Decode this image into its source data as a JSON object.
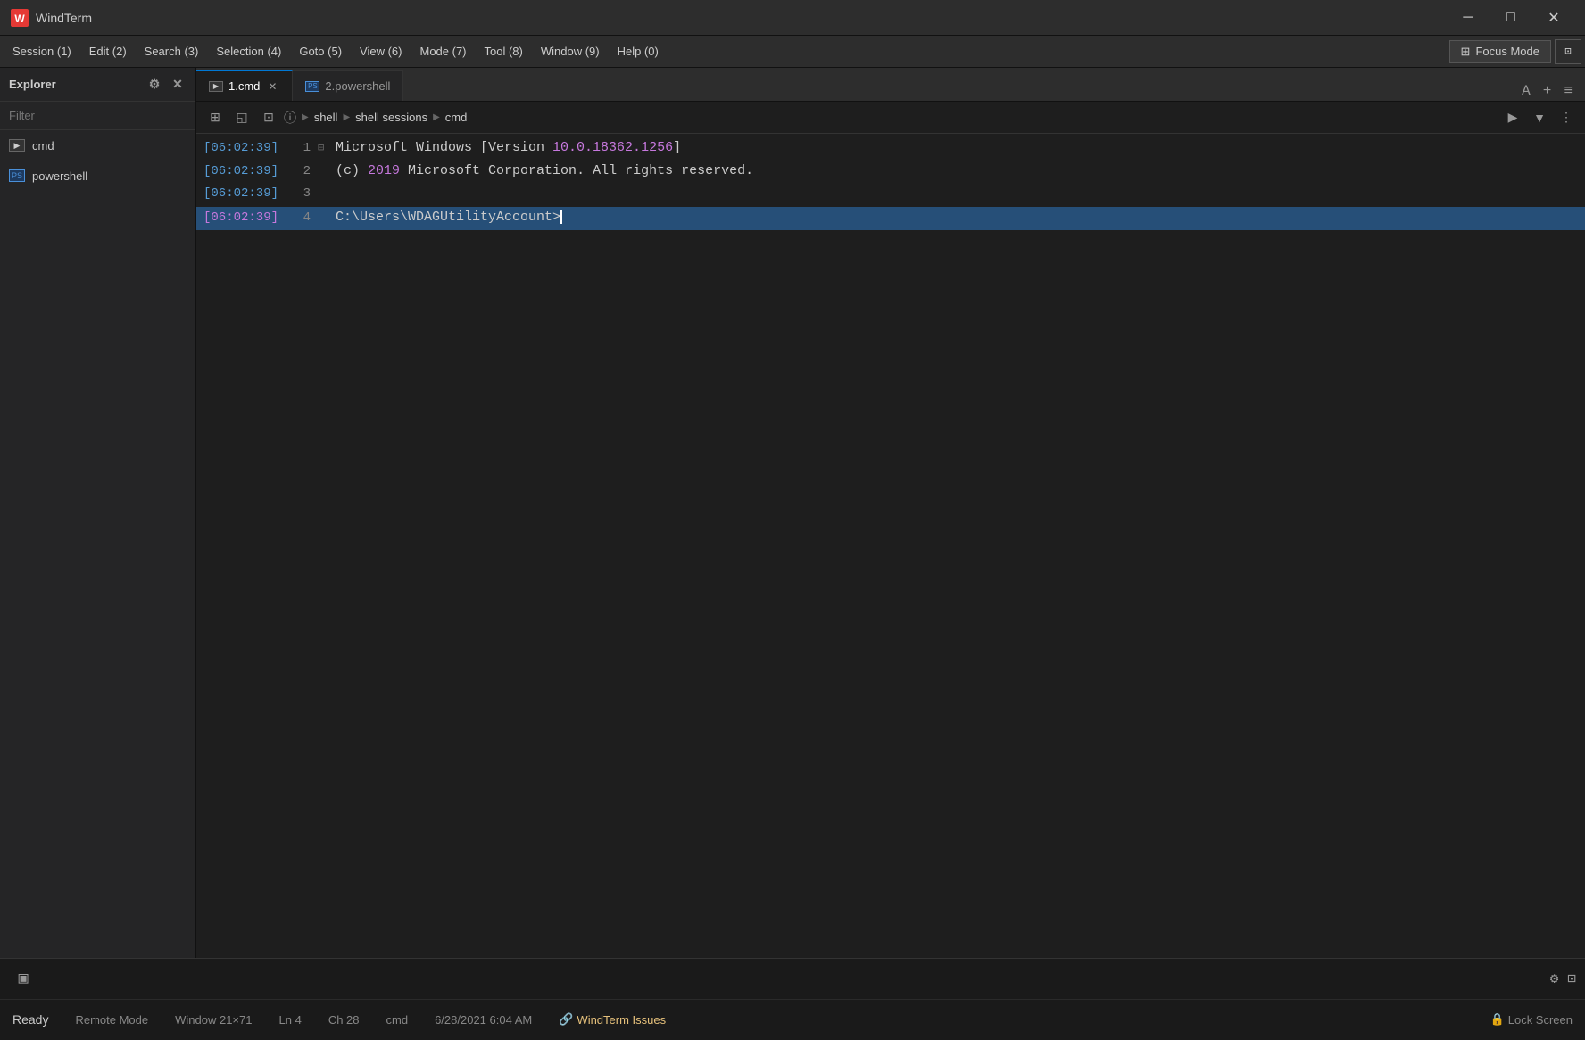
{
  "app": {
    "title": "WindTerm",
    "logo_color": "#e53935"
  },
  "title_controls": {
    "minimize": "─",
    "maximize": "□",
    "close": "✕"
  },
  "menu": {
    "items": [
      "Session (1)",
      "Edit (2)",
      "Search (3)",
      "Selection (4)",
      "Goto (5)",
      "View (6)",
      "Mode (7)",
      "Tool (8)",
      "Window (9)",
      "Help (0)"
    ],
    "focus_mode": "Focus Mode"
  },
  "sidebar": {
    "title": "Explorer",
    "filter_placeholder": "Filter",
    "items": [
      {
        "label": "cmd",
        "type": "cmd"
      },
      {
        "label": "powershell",
        "type": "powershell"
      }
    ]
  },
  "tabs": [
    {
      "label": "1.cmd",
      "type": "cmd",
      "active": true,
      "closeable": true
    },
    {
      "label": "2.powershell",
      "type": "powershell",
      "active": false,
      "closeable": false
    }
  ],
  "toolbar": {
    "info_icon": "ⓘ",
    "breadcrumb": {
      "part1": "shell",
      "part2": "shell sessions",
      "part3": "cmd"
    }
  },
  "terminal": {
    "lines": [
      {
        "timestamp": "[06:02:39]",
        "num": "1",
        "fold": "⊟",
        "content_parts": [
          {
            "text": "Microsoft Windows [Version ",
            "class": "c-white"
          },
          {
            "text": "10.0.18362.1256",
            "class": "c-purple"
          },
          {
            "text": "]",
            "class": "c-white"
          }
        ],
        "active": false
      },
      {
        "timestamp": "[06:02:39]",
        "num": "2",
        "fold": "",
        "content_parts": [
          {
            "text": "(c) ",
            "class": "c-white"
          },
          {
            "text": "2019",
            "class": "c-purple"
          },
          {
            "text": " Microsoft Corporation. All rights reserved.",
            "class": "c-white"
          }
        ],
        "active": false
      },
      {
        "timestamp": "[06:02:39]",
        "num": "3",
        "fold": "",
        "content_parts": [],
        "active": false
      },
      {
        "timestamp": "[06:02:39]",
        "num": "4",
        "fold": "",
        "content_parts": [
          {
            "text": "C:\\Users\\WDAGUtilityAccount>",
            "class": "c-white"
          }
        ],
        "active": true,
        "has_cursor": true
      }
    ]
  },
  "status": {
    "ready": "Ready",
    "remote_mode": "Remote Mode",
    "window": "Window 21×71",
    "ln": "Ln 4",
    "ch": "Ch 28",
    "shell": "cmd",
    "datetime": "6/28/2021  6:04 AM",
    "issues": "WindTerm Issues",
    "lock": "Lock Screen"
  }
}
